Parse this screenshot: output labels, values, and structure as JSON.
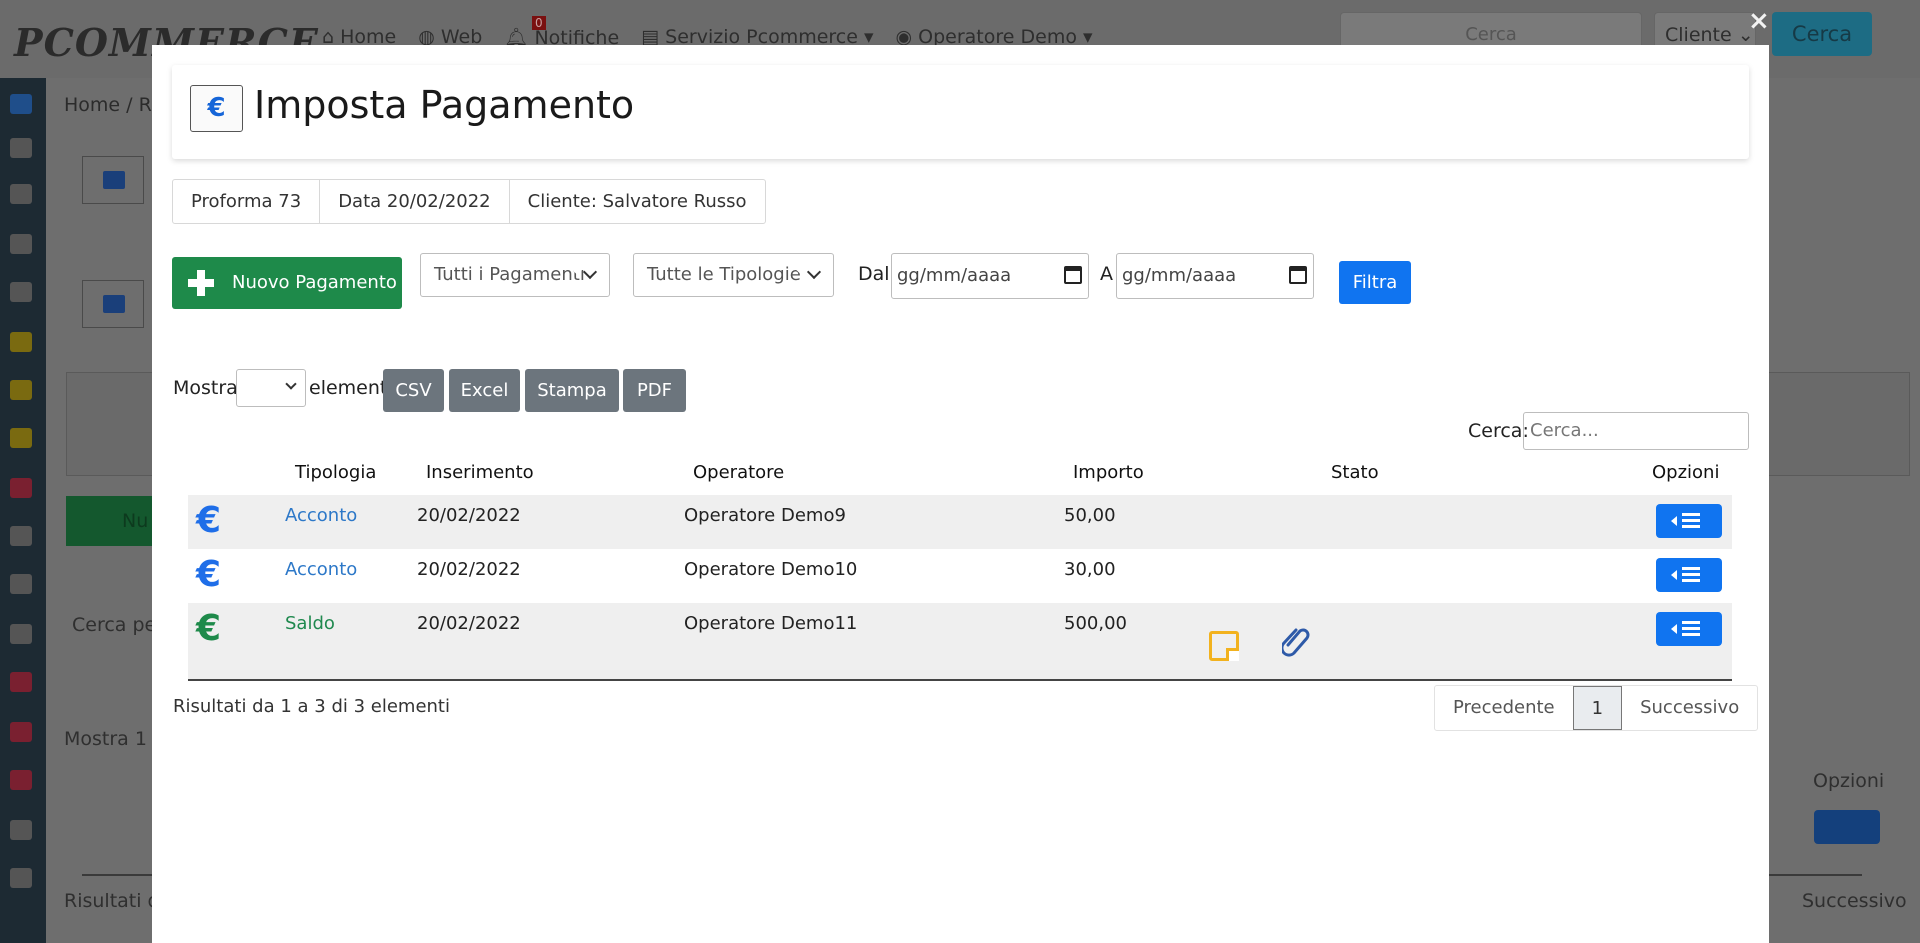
{
  "background": {
    "logo": "PCOMMERCE",
    "nav": [
      "Home",
      "Web",
      "Notifiche",
      "Servizio Pcommerce",
      "Operatore Demo"
    ],
    "notification_count": "0",
    "top_search_placeholder": "Cerca",
    "top_select_value": "Cliente",
    "top_search_button": "Cerca",
    "breadcrumb": "Home  /  R",
    "new_button": "Nu",
    "search_placeholder": "Cerca per",
    "show_label": "Mostra",
    "show_value": "1",
    "options_header": "Opzioni",
    "results_text": "Risultati da",
    "next_label": "Successivo"
  },
  "modal": {
    "close_label": "×",
    "title_icon": "€",
    "title": "Imposta Pagamento",
    "info": [
      "Proforma 73",
      "Data 20/02/2022",
      "Cliente: Salvatore Russo"
    ],
    "new_payment_label": "Nuovo Pagamento",
    "filter_payments_value": "Tutti i Pagamenti",
    "filter_types_value": "Tutte le Tipologie",
    "date_from_label": "Dal",
    "date_to_label": "A",
    "date_placeholder": "gg/mm/aaaa",
    "filter_button": "Filtra",
    "show_label": "Mostra",
    "elements_label": "elementi",
    "export_buttons": [
      "CSV",
      "Excel",
      "Stampa",
      "PDF"
    ],
    "search_label": "Cerca:",
    "search_placeholder": "Cerca...",
    "table": {
      "headers": [
        "Tipologia",
        "Inserimento",
        "Operatore",
        "Importo",
        "Stato",
        "Opzioni"
      ],
      "rows": [
        {
          "type": "Acconto",
          "date": "20/02/2022",
          "operator": "Operatore Demo9",
          "amount": "50,00"
        },
        {
          "type": "Acconto",
          "date": "20/02/2022",
          "operator": "Operatore Demo10",
          "amount": "30,00"
        },
        {
          "type": "Saldo",
          "date": "20/02/2022",
          "operator": "Operatore Demo11",
          "amount": "500,00"
        }
      ]
    },
    "results_text": "Risultati da 1 a 3 di 3 elementi",
    "pagination": [
      "Precedente",
      "1",
      "Successivo"
    ]
  },
  "colors": {
    "primary": "#1074f0",
    "success": "#1e8a4a",
    "secondary": "#6c757d",
    "note": "#f2b21e"
  }
}
